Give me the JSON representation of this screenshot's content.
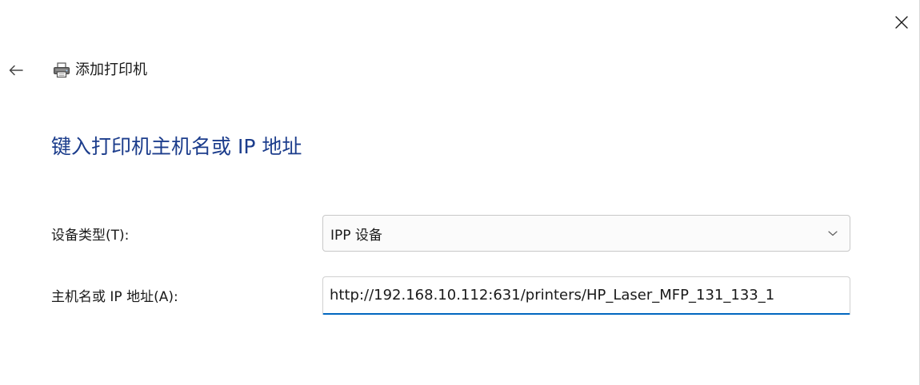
{
  "window": {
    "title": "添加打印机",
    "close_icon": "close-icon",
    "back_icon": "back-arrow-icon",
    "printer_icon": "printer-icon"
  },
  "main": {
    "heading": "键入打印机主机名或 IP 地址"
  },
  "form": {
    "device_type": {
      "label": "设备类型(T):",
      "selected_value": "IPP 设备",
      "dropdown_icon": "chevron-down-icon"
    },
    "host": {
      "label": "主机名或 IP 地址(A):",
      "value": "http://192.168.10.112:631/printers/HP_Laser_MFP_131_133_1"
    }
  },
  "colors": {
    "heading": "#1c3d8c",
    "input_focus_underline": "#0067c0",
    "text": "#1a1a1a",
    "border": "#c8c8c8",
    "background": "#ffffff"
  }
}
